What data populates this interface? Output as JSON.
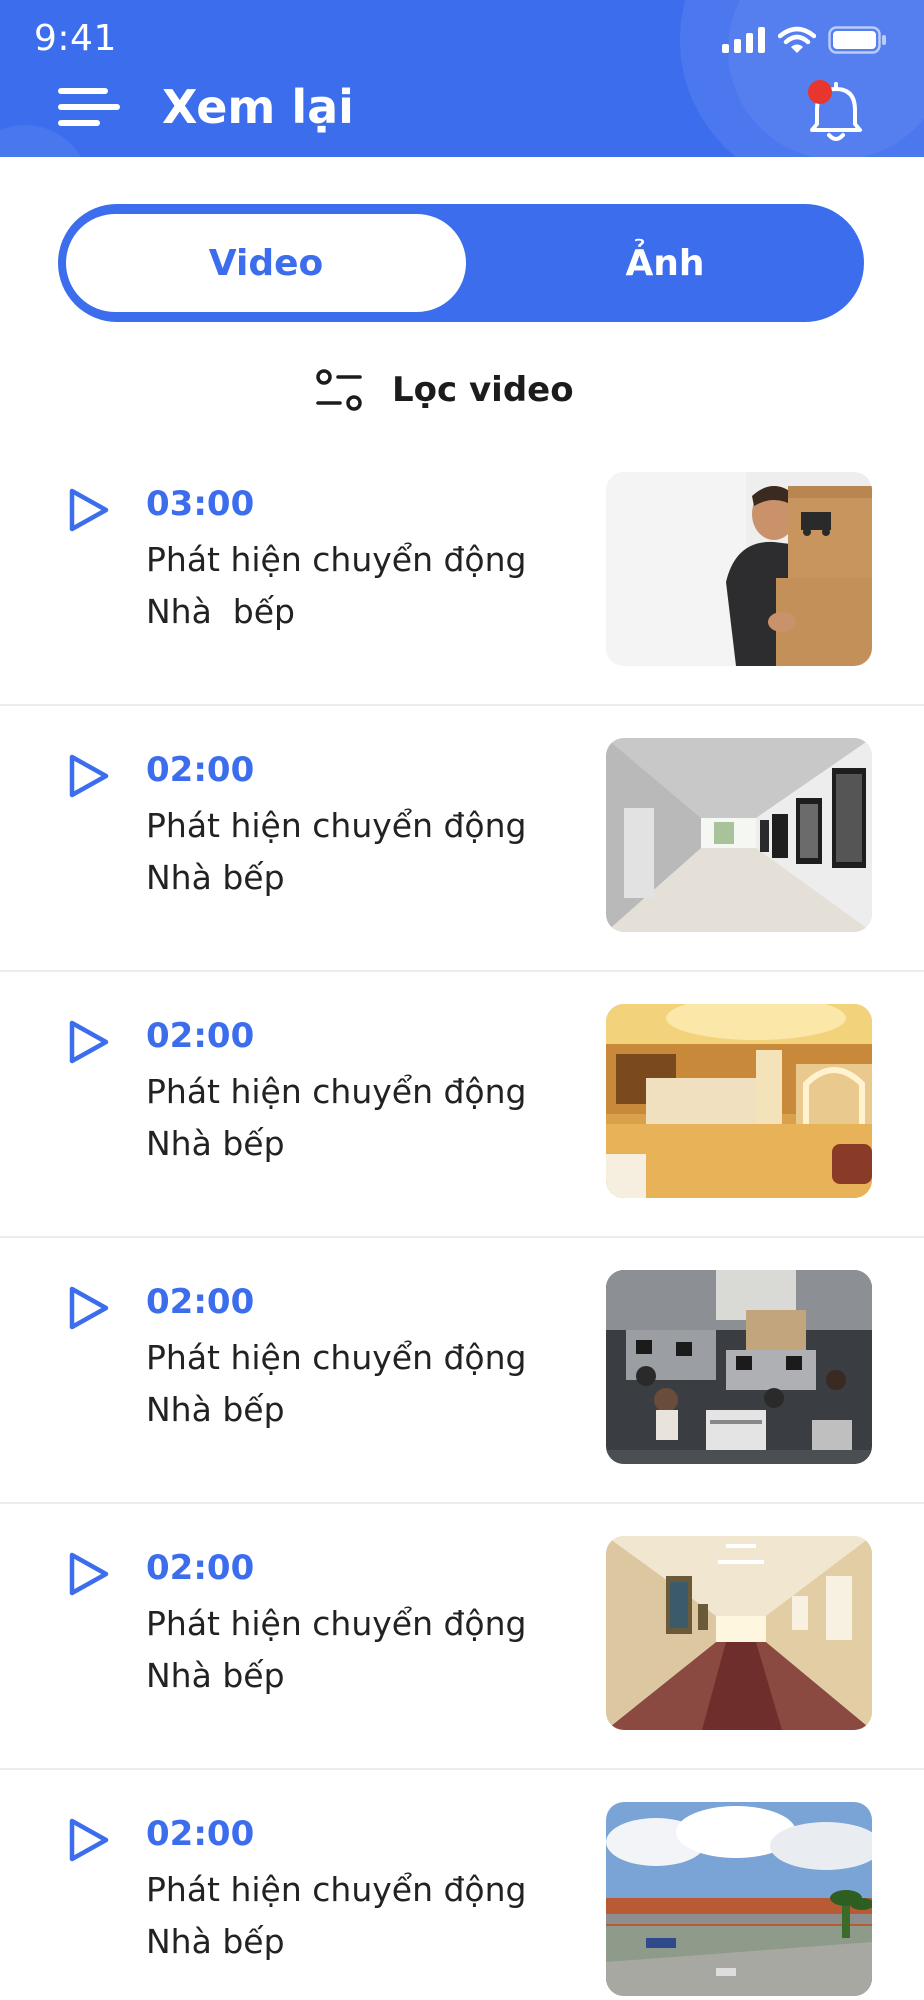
{
  "status_bar": {
    "time": "9:41",
    "icons": [
      "cellular-signal-icon",
      "wifi-icon",
      "battery-icon"
    ]
  },
  "header": {
    "title": "Xem lại",
    "menu_icon": "hamburger-menu-icon",
    "notification_icon": "bell-icon",
    "notification_dot_color": "#e8362e"
  },
  "tabs": [
    {
      "label": "Video",
      "active": true
    },
    {
      "label": "Ảnh",
      "active": false
    }
  ],
  "filter": {
    "label": "Lọc video",
    "icon": "filter-icon"
  },
  "recordings": [
    {
      "time": "03:00",
      "event": "Phát hiện chuyển động",
      "location": "Nhà  bếp",
      "thumbnail": "delivery-man-with-boxes"
    },
    {
      "time": "02:00",
      "event": "Phát hiện chuyển động",
      "location": "Nhà bếp",
      "thumbnail": "white-gallery-hallway"
    },
    {
      "time": "02:00",
      "event": "Phát hiện chuyển động",
      "location": "Nhà bếp",
      "thumbnail": "hotel-lobby"
    },
    {
      "time": "02:00",
      "event": "Phát hiện chuyển động",
      "location": "Nhà bếp",
      "thumbnail": "office-cctv-view"
    },
    {
      "time": "02:00",
      "event": "Phát hiện chuyển động",
      "location": "Nhà bếp",
      "thumbnail": "hotel-corridor"
    },
    {
      "time": "02:00",
      "event": "Phát hiện chuyển động",
      "location": "Nhà bếp",
      "thumbnail": "factory-exterior"
    }
  ],
  "colors": {
    "primary": "#3c6ded",
    "text": "#222222",
    "divider": "#ececec"
  }
}
